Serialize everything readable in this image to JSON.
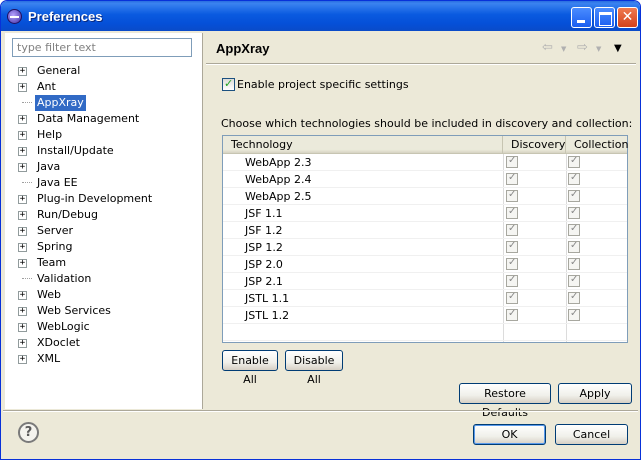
{
  "window": {
    "title": "Preferences"
  },
  "filter": {
    "placeholder": "type filter text"
  },
  "tree": [
    {
      "label": "General",
      "expandable": true
    },
    {
      "label": "Ant",
      "expandable": true
    },
    {
      "label": "AppXray",
      "expandable": false,
      "selected": true
    },
    {
      "label": "Data Management",
      "expandable": true
    },
    {
      "label": "Help",
      "expandable": true
    },
    {
      "label": "Install/Update",
      "expandable": true
    },
    {
      "label": "Java",
      "expandable": true
    },
    {
      "label": "Java EE",
      "expandable": false
    },
    {
      "label": "Plug-in Development",
      "expandable": true
    },
    {
      "label": "Run/Debug",
      "expandable": true
    },
    {
      "label": "Server",
      "expandable": true
    },
    {
      "label": "Spring",
      "expandable": true
    },
    {
      "label": "Team",
      "expandable": true
    },
    {
      "label": "Validation",
      "expandable": false
    },
    {
      "label": "Web",
      "expandable": true
    },
    {
      "label": "Web Services",
      "expandable": true
    },
    {
      "label": "WebLogic",
      "expandable": true
    },
    {
      "label": "XDoclet",
      "expandable": true
    },
    {
      "label": "XML",
      "expandable": true
    }
  ],
  "page": {
    "title": "AppXray",
    "enable_label": "Enable project specific settings",
    "enable_checked": true,
    "choose_text": "Choose which technologies should be included in discovery and collection:"
  },
  "table": {
    "headers": {
      "technology": "Technology",
      "discovery": "Discovery",
      "collection": "Collection"
    },
    "rows": [
      {
        "name": "WebApp 2.3",
        "discovery": true,
        "collection": true
      },
      {
        "name": "WebApp 2.4",
        "discovery": true,
        "collection": true
      },
      {
        "name": "WebApp 2.5",
        "discovery": true,
        "collection": true
      },
      {
        "name": "JSF 1.1",
        "discovery": true,
        "collection": true
      },
      {
        "name": "JSF 1.2",
        "discovery": true,
        "collection": true
      },
      {
        "name": "JSP 1.2",
        "discovery": true,
        "collection": true
      },
      {
        "name": "JSP 2.0",
        "discovery": true,
        "collection": true
      },
      {
        "name": "JSP 2.1",
        "discovery": true,
        "collection": true
      },
      {
        "name": "JSTL 1.1",
        "discovery": true,
        "collection": true
      },
      {
        "name": "JSTL 1.2",
        "discovery": true,
        "collection": true
      }
    ]
  },
  "buttons": {
    "enable_all": "Enable All",
    "disable_all": "Disable All",
    "restore_defaults": "Restore Defaults",
    "apply": "Apply",
    "ok": "OK",
    "cancel": "Cancel"
  },
  "icons": {
    "app": "eclipse-icon",
    "back": "back-arrow-icon",
    "forward": "forward-arrow-icon",
    "view_menu": "view-menu-icon",
    "help": "help-icon"
  },
  "colors": {
    "title_bar": "#0a5ae0",
    "selection": "#316ac5",
    "dialog_bg": "#ece9d8"
  }
}
